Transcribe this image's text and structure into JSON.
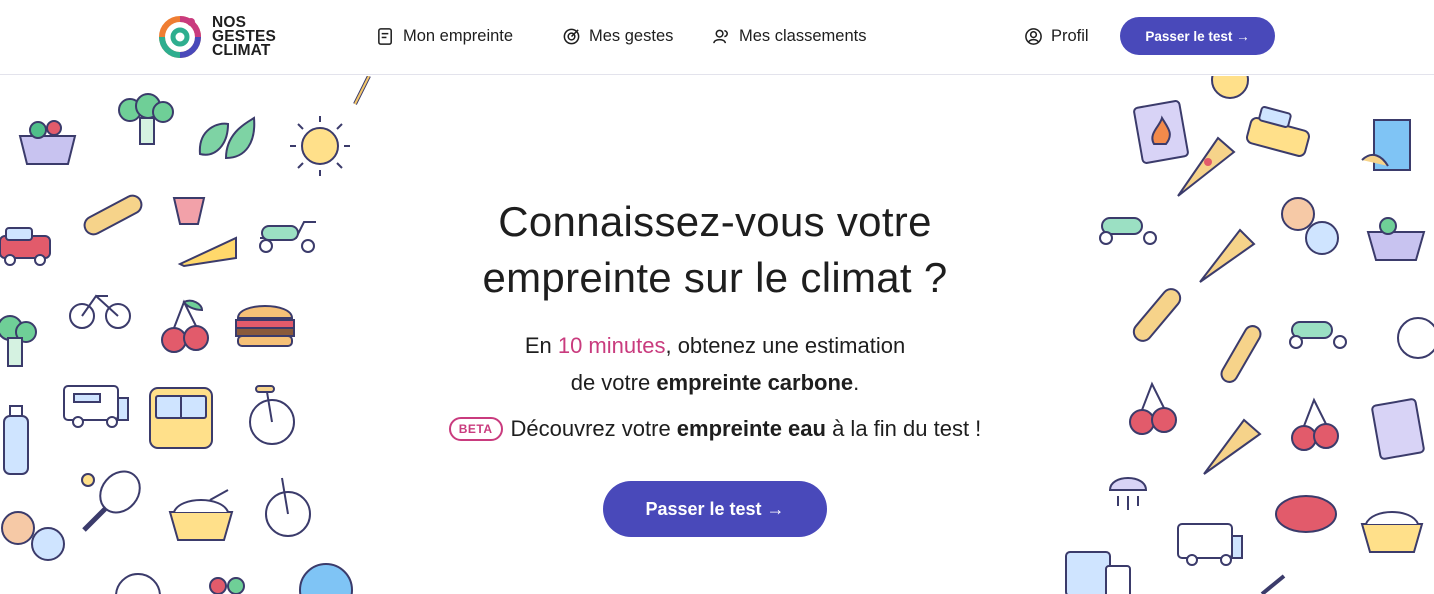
{
  "brand": {
    "logo_lines": [
      "NOS",
      "GESTES",
      "CLIMAT"
    ]
  },
  "nav": {
    "empreinte": "Mon empreinte",
    "gestes": "Mes gestes",
    "classements": "Mes classements",
    "profil": "Profil",
    "cta": "Passer le test →"
  },
  "hero": {
    "title_line1": "Connaissez-vous votre",
    "title_line2": "empreinte sur le climat ?",
    "sub_prefix": "En ",
    "sub_accent": "10 minutes",
    "sub_mid": ", obtenez une estimation",
    "sub_line2_prefix": "de votre ",
    "sub_line2_bold": "empreinte carbone",
    "sub_line2_suffix": ".",
    "beta_badge": "BETA",
    "beta_prefix": "Découvrez votre ",
    "beta_bold": "empreinte eau",
    "beta_suffix": " à la fin du test !",
    "cta": "Passer le test →"
  },
  "colors": {
    "primary": "#4949ba",
    "accent": "#c93b7e",
    "text": "#1e1e1e"
  },
  "icons": [
    "logo-ring-icon",
    "list-icon",
    "target-check-icon",
    "people-icon",
    "user-circle-icon"
  ]
}
